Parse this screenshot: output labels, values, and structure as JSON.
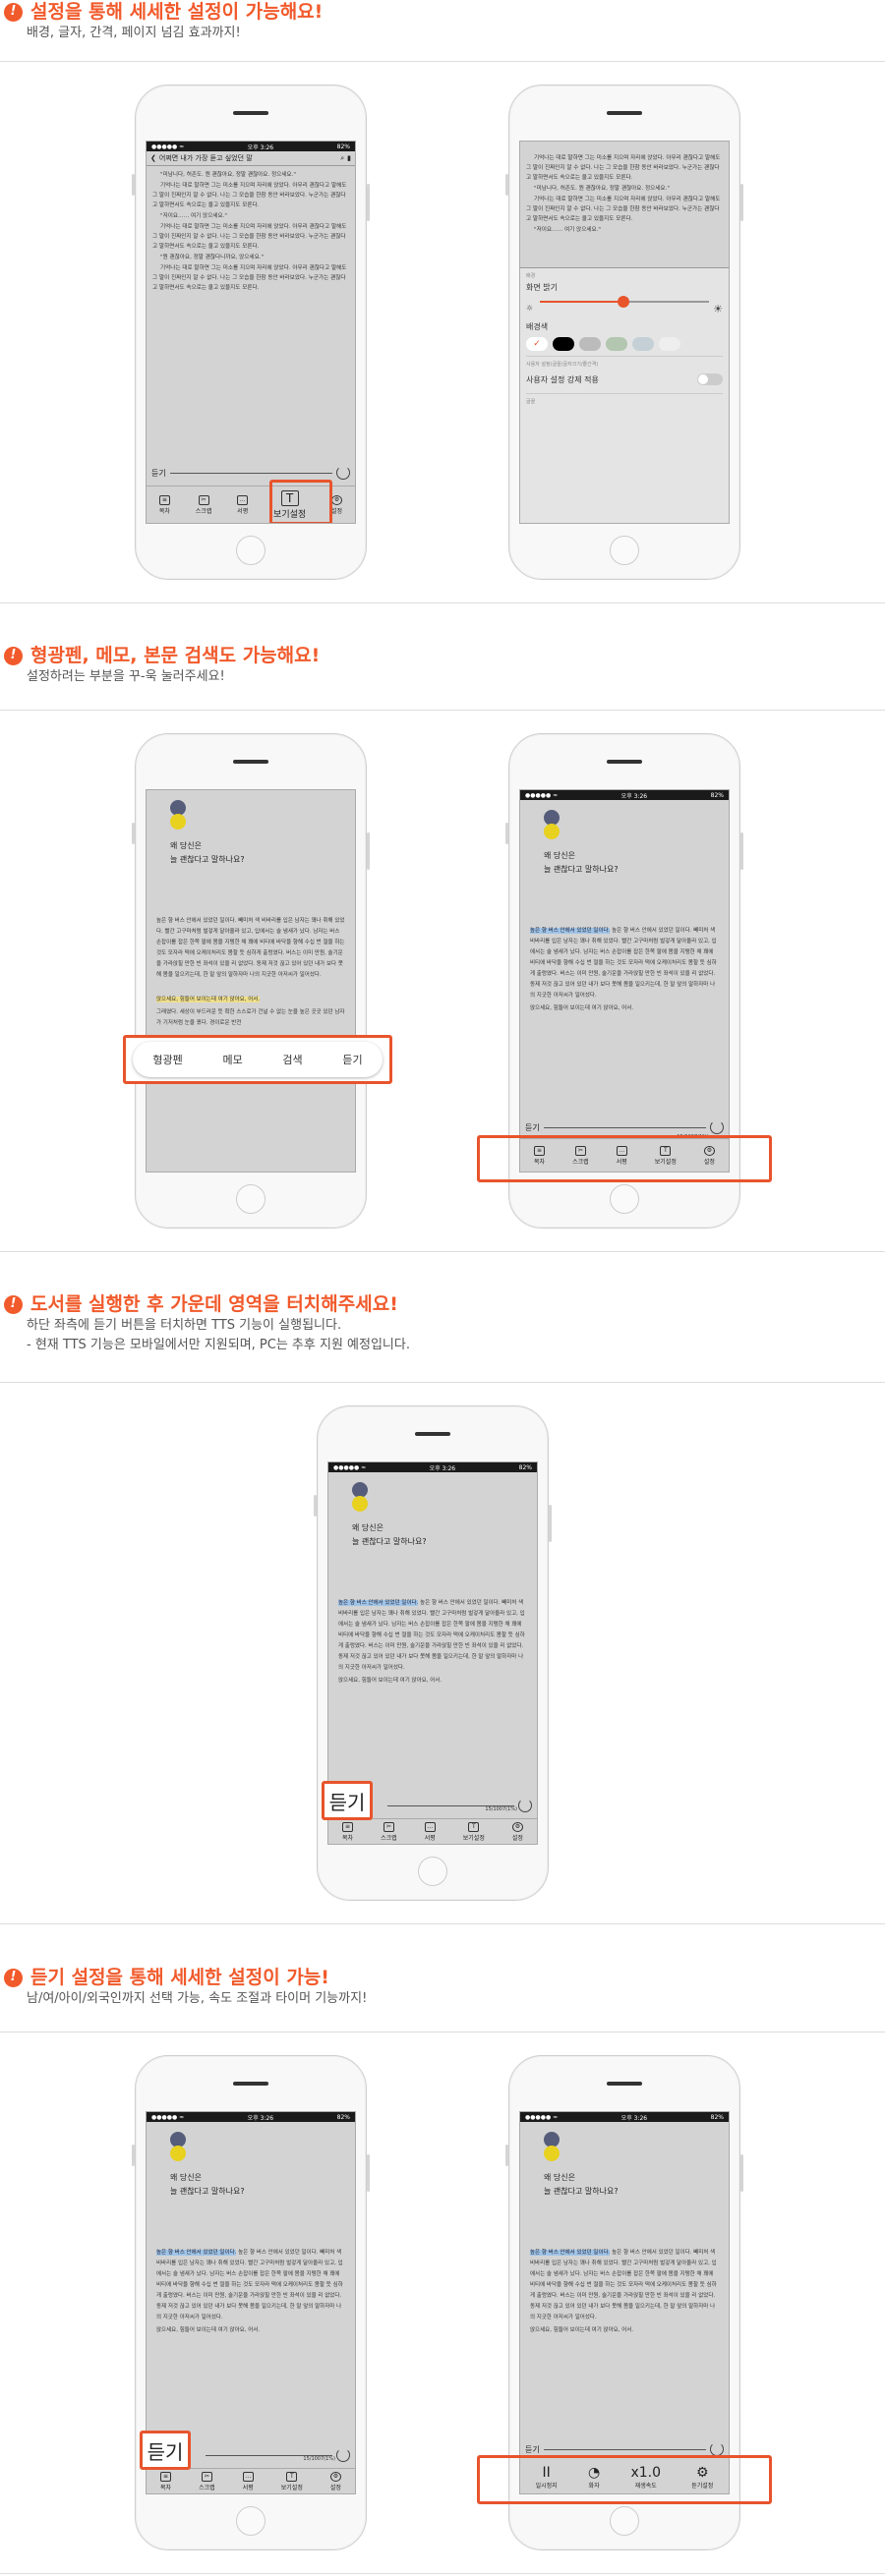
{
  "sections": [
    {
      "title": "설정을 통해 세세한 설정이 가능해요!",
      "sub": "배경, 글자, 간격, 페이지 넘김 효과까지!"
    },
    {
      "title": "형광펜, 메모, 본문 검색도 가능해요!",
      "sub": "설정하려는 부분을 꾸-욱 눌러주세요!"
    },
    {
      "title": "도서를 실행한 후 가운데 영역을 터치해주세요!",
      "sub": "하단 좌측에 듣기 버튼을 터치하면 TTS 기능이 실행됩니다.",
      "sub2": "- 현재 TTS 기능은 모바일에서만 지원되며, PC는 추후 지원 예정입니다."
    },
    {
      "title": "듣기 설정을 통해 세세한 설정이 가능!",
      "sub": "남/여/아이/외국인까지 선택 가능, 속도 조절과 타이머 기능까지!"
    }
  ],
  "status": {
    "time": "오후 3:26",
    "battery": "82%"
  },
  "book": {
    "nav_title": "어쩌면 내가 가장 듣고 싶었던 말",
    "chapter_title": "왜 당신은\n늘 괜찮다고 말하나요?",
    "highlight": "높은 향 버스 안에서 있었던 일이다.",
    "para1": "높은 향 버스 안에서 있었던 일이다. 빼미처 색 비바리를 입은 남자는 꽤나 취해 있었다. 빨간 고구마처럼 벌겋게 달아올라 있고, 입에서는 술 냄새가 났다. 남자는 버스 손잡이를 잡은 한쪽 팔에 몸을 지탱한 채 꽤에 비티에 바닥을 향해 수십 번 절을 하는 것도 모자라 떡에 오케이처리도 몸할 듯 심하게 출렁였다. 버스는 이미 만원, 술기운을 가라앉힐 만한 빈 좌석이 있을 리 없었다. 동제 저것 끊고 있어 있던 내가 보다 못해 몸을 일으키는데, 한 말 앞의 말하자마 나의 지긋한 아저씨가 일어섰다.",
    "quote": "앉으세요, 힘들어 보이는데 여기 앉아요, 어서.",
    "para2": "그래였다. 세상이 부드러운 듯 확한 스스로가 건널 수 없는 눈을 높은 곳곳 있던 남자가 기저처럼 눈을 꿨다. 경이로운 반전",
    "page_text": "기억나는 대로 말하면 그는 미소를 지으며 자리에 앉았다. 아무리 괜찮다고 말해도 그 말이 진짜인지 알 수 없다. 나는 그 모습을 한참 동안 바라보았다. 누군가는 괜찮다고 말하면서도 속으로는 울고 있을지도 모른다.",
    "dialogue1": "\"미남니다, 허존도. 뭔 괜찮아요, 정말 괜찮아요. 정으세요.\"",
    "dialogue2": "\"저이요……  여기 앉으세요.\"",
    "dialogue3": "\"뭔 괜찮아요, 정말 괜찮다니까요, 앉으세요.\"",
    "page_num": "15/1007(1%)"
  },
  "listen_label": "듣기",
  "toolbar": [
    "목차",
    "스크랩",
    "서평",
    "보기설정",
    "설정"
  ],
  "toolbar_icons": [
    "list-icon",
    "scrap-icon",
    "comment-icon",
    "text-icon",
    "gear-icon"
  ],
  "popup_menu": [
    "형광펜",
    "메모",
    "검색",
    "듣기"
  ],
  "view_settings": {
    "brightness": "화면 밝기",
    "bg_color": "배경색",
    "user_note": "사용자 설정(글꼴/글자크기/줄간격)",
    "force": "사용자 설정 강제 적용",
    "font": "글꼴",
    "edge_label": "배경"
  },
  "tts_bar": [
    {
      "icon": "pause-icon",
      "glyph": "II",
      "label": "일시정지"
    },
    {
      "icon": "voice-icon",
      "glyph": "",
      "label": "화자"
    },
    {
      "icon": "speed-icon",
      "glyph": "x1.0",
      "label": "재생속도"
    },
    {
      "icon": "gear-icon",
      "glyph": "",
      "label": "듣기설정"
    }
  ],
  "colors": {
    "accent": "#f15a2b",
    "highlight": "#9fc4e8",
    "screen": "#d3d3d3"
  }
}
